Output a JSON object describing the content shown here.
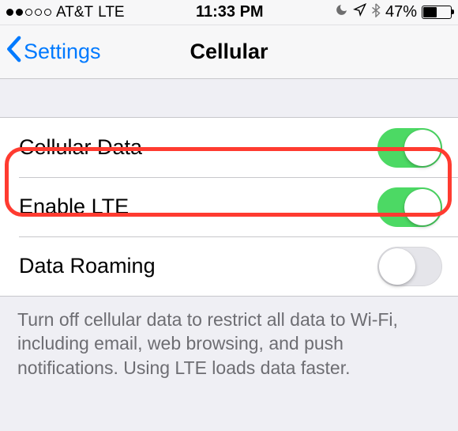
{
  "status": {
    "carrier": "AT&T",
    "network": "LTE",
    "time": "11:33 PM",
    "battery_pct": "47%"
  },
  "nav": {
    "back_label": "Settings",
    "title": "Cellular"
  },
  "rows": {
    "cellular_data": {
      "label": "Cellular Data",
      "on": true
    },
    "enable_lte": {
      "label": "Enable LTE",
      "on": true
    },
    "data_roaming": {
      "label": "Data Roaming",
      "on": false
    }
  },
  "footer": "Turn off cellular data to restrict all data to Wi-Fi, including email, web browsing, and push notifications. Using LTE loads data faster.",
  "colors": {
    "tint": "#007aff",
    "toggle_on": "#4cd964",
    "annotation": "#ff3b30"
  }
}
